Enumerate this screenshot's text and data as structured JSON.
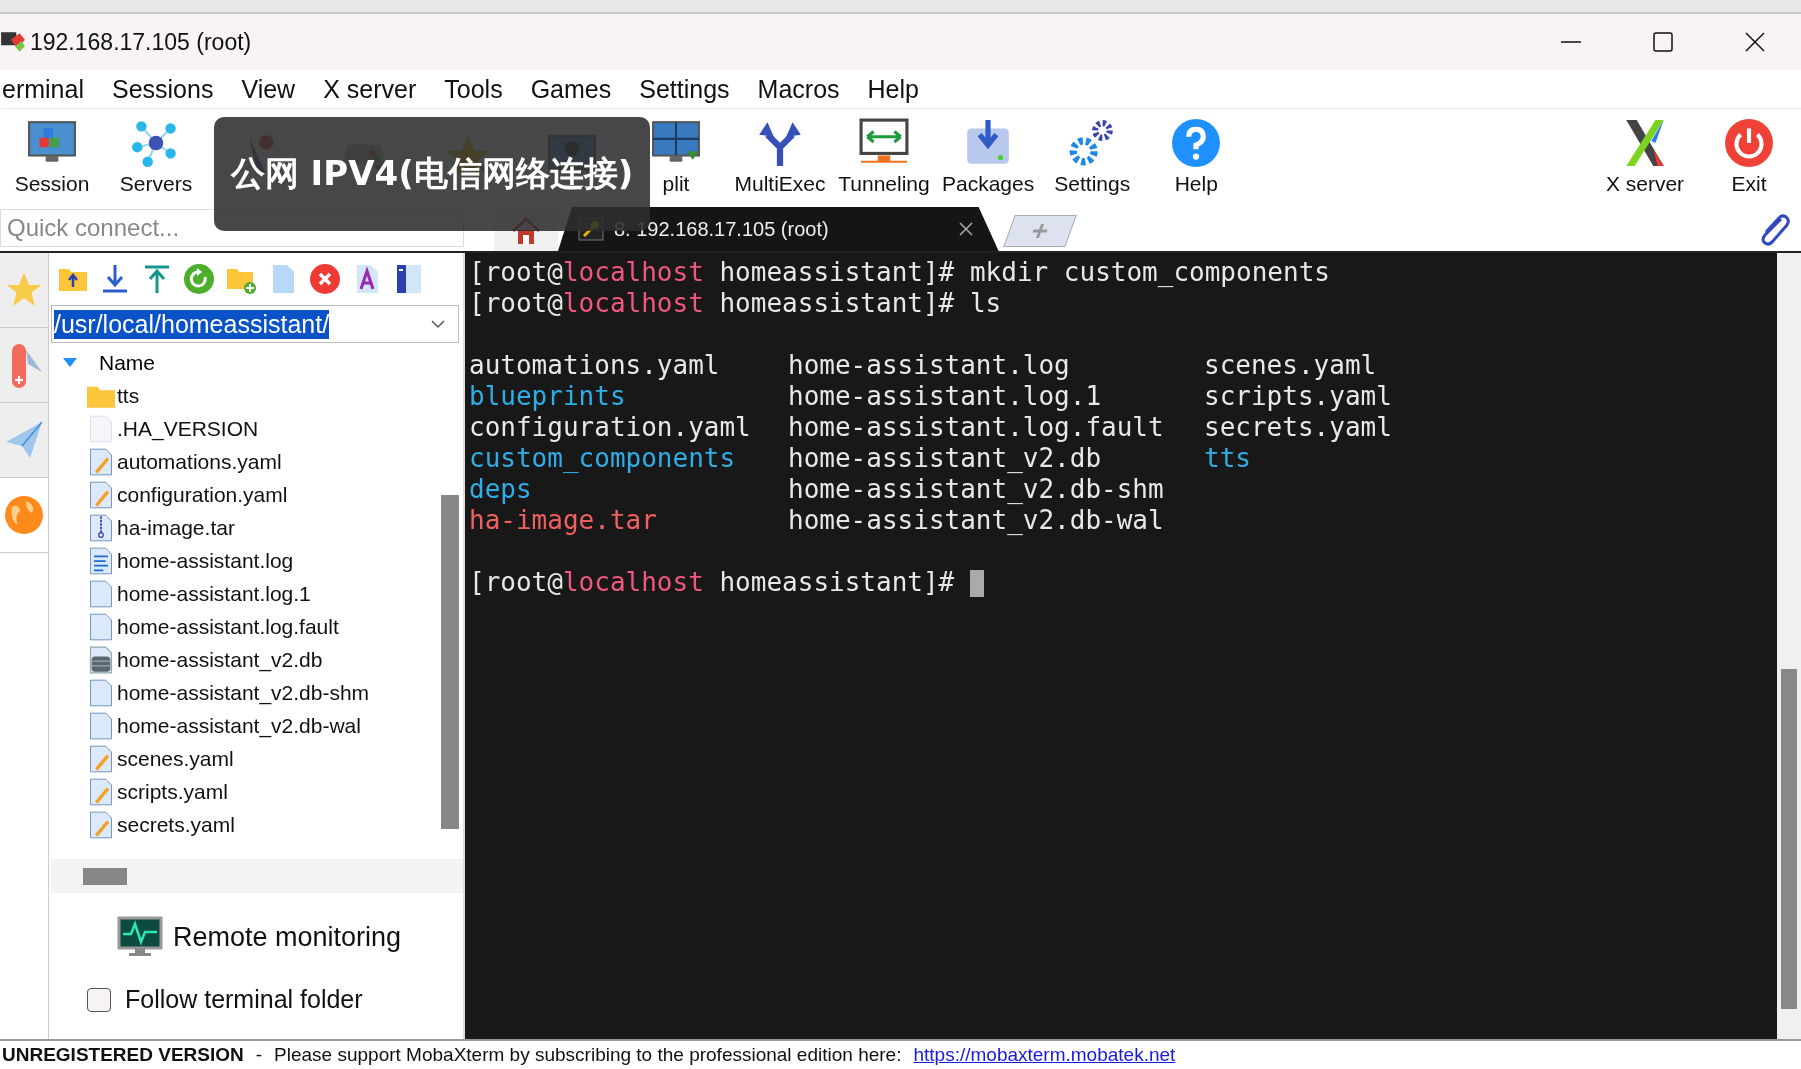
{
  "window": {
    "title": "192.168.17.105 (root)"
  },
  "menu": [
    "erminal",
    "Sessions",
    "View",
    "X server",
    "Tools",
    "Games",
    "Settings",
    "Macros",
    "Help"
  ],
  "toolbar": [
    {
      "kind": "session",
      "label": "Session"
    },
    {
      "kind": "servers",
      "label": "Servers"
    },
    {
      "kind": "tools"
    },
    {
      "kind": "games"
    },
    {
      "kind": "sessions"
    },
    {
      "kind": "view"
    },
    {
      "kind": "split",
      "label": "plit"
    },
    {
      "kind": "multiexec",
      "label": "MultiExec"
    },
    {
      "kind": "tunneling",
      "label": "Tunneling"
    },
    {
      "kind": "packages",
      "label": "Packages"
    },
    {
      "kind": "settings",
      "label": "Settings"
    },
    {
      "kind": "help",
      "label": "Help"
    }
  ],
  "toolbar_right": [
    {
      "kind": "xserver",
      "label": "X server"
    },
    {
      "kind": "exit",
      "label": "Exit"
    }
  ],
  "overlay": {
    "text": "公网 IPV4(电信网络连接)"
  },
  "quick_connect": {
    "placeholder": "Quick connect..."
  },
  "tabs": [
    {
      "kind": "home",
      "selected": false
    },
    {
      "kind": "session",
      "label": "8. 192.168.17.105 (root)",
      "selected": true
    },
    {
      "kind": "new",
      "selected": false
    }
  ],
  "file_browser": {
    "path": "/usr/local/homeassistant/",
    "column": "Name",
    "files": [
      {
        "name": "tts",
        "kind": "folder"
      },
      {
        "name": ".HA_VERSION",
        "kind": "blank"
      },
      {
        "name": "automations.yaml",
        "kind": "edit"
      },
      {
        "name": "configuration.yaml",
        "kind": "edit"
      },
      {
        "name": "ha-image.tar",
        "kind": "archive"
      },
      {
        "name": "home-assistant.log",
        "kind": "text"
      },
      {
        "name": "home-assistant.log.1",
        "kind": "file"
      },
      {
        "name": "home-assistant.log.fault",
        "kind": "file"
      },
      {
        "name": "home-assistant_v2.db",
        "kind": "db"
      },
      {
        "name": "home-assistant_v2.db-shm",
        "kind": "file"
      },
      {
        "name": "home-assistant_v2.db-wal",
        "kind": "file"
      },
      {
        "name": "scenes.yaml",
        "kind": "edit"
      },
      {
        "name": "scripts.yaml",
        "kind": "edit"
      },
      {
        "name": "secrets.yaml",
        "kind": "edit"
      }
    ],
    "remote_monitoring": "Remote monitoring",
    "follow_terminal_folder": {
      "label": "Follow terminal folder",
      "checked": false
    }
  },
  "terminal": {
    "lines": [
      [
        {
          "text": "[root@",
          "kind": "plain"
        },
        {
          "text": "localhost",
          "kind": "host"
        },
        {
          "text": " homeassistant]# mkdir custom_components",
          "kind": "plain"
        }
      ],
      [
        {
          "text": "[root@",
          "kind": "plain"
        },
        {
          "text": "localhost",
          "kind": "host"
        },
        {
          "text": " homeassistant]# ls",
          "kind": "plain"
        }
      ]
    ],
    "listing": [
      [
        {
          "text": "automations.yaml",
          "kind": "plain"
        },
        {
          "text": "home-assistant.log",
          "kind": "plain"
        },
        {
          "text": "scenes.yaml",
          "kind": "plain"
        }
      ],
      [
        {
          "text": "blueprints",
          "kind": "dir"
        },
        {
          "text": "home-assistant.log.1",
          "kind": "plain"
        },
        {
          "text": "scripts.yaml",
          "kind": "plain"
        }
      ],
      [
        {
          "text": "configuration.yaml",
          "kind": "plain"
        },
        {
          "text": "home-assistant.log.fault",
          "kind": "plain"
        },
        {
          "text": "secrets.yaml",
          "kind": "plain"
        }
      ],
      [
        {
          "text": "custom_components",
          "kind": "dir"
        },
        {
          "text": "home-assistant_v2.db",
          "kind": "plain"
        },
        {
          "text": "tts",
          "kind": "dir"
        }
      ],
      [
        {
          "text": "deps",
          "kind": "dir"
        },
        {
          "text": "home-assistant_v2.db-shm",
          "kind": "plain"
        }
      ],
      [
        {
          "text": "ha-image.tar",
          "kind": "archive"
        },
        {
          "text": "home-assistant_v2.db-wal",
          "kind": "plain"
        }
      ]
    ],
    "prompt": [
      {
        "text": "[root@",
        "kind": "plain"
      },
      {
        "text": "localhost",
        "kind": "host"
      },
      {
        "text": " homeassistant]# ",
        "kind": "plain"
      }
    ]
  },
  "status_bar": {
    "label": "UNREGISTERED VERSION",
    "separator": "-",
    "message": "Please support MobaXterm by subscribing to the professional edition here:",
    "link": "https://mobaxterm.mobatek.net"
  }
}
